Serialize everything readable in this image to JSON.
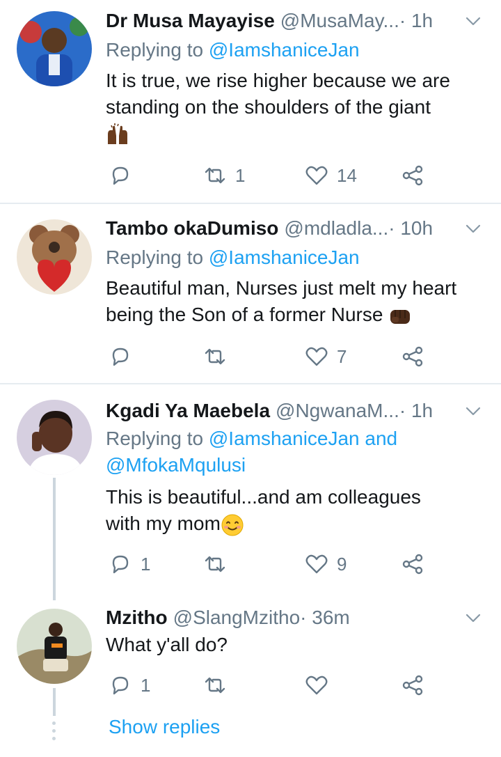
{
  "tweets": [
    {
      "name": "Dr Musa Mayayise",
      "handle": "@MusaMay...",
      "time": " · 1h",
      "replying_prefix": "Replying to ",
      "replying_to": "@IamshaniceJan",
      "text_line1": "It is true, we rise higher because we are",
      "text_line2": "standing on the shoulders of the giant",
      "emoji": "raising-hands-emoji",
      "replies": "",
      "retweets": "1",
      "likes": "14"
    },
    {
      "name": "Tambo okaDumiso",
      "handle": "@mdladla...",
      "time": " · 10h",
      "replying_prefix": "Replying to ",
      "replying_to": "@IamshaniceJan",
      "text_line1": "Beautiful man, Nurses just melt my heart",
      "text_line2": "being the Son of a former Nurse ",
      "emoji": "fist-emoji",
      "replies": "",
      "retweets": "",
      "likes": "7"
    },
    {
      "name": "Kgadi Ya Maebela",
      "handle": "@NgwanaM...",
      "time": " · 1h",
      "replying_prefix": "Replying to ",
      "replying_to": "@IamshaniceJan and",
      "replying_to2": "@MfokaMqulusi",
      "text_line1": "This is beautiful...and am colleagues",
      "text_line2": "with my mom",
      "emoji": "smiling-face-emoji",
      "replies": "1",
      "retweets": "",
      "likes": "9"
    },
    {
      "name": "Mzitho",
      "handle": "@SlangMzitho",
      "time": " · 36m",
      "text_line1": "What y'all do?",
      "replies": "1",
      "retweets": "",
      "likes": ""
    }
  ],
  "show_replies": "Show replies",
  "colors": {
    "link": "#1da1f2",
    "secondary_text": "#657786",
    "divider": "#e6ecf0",
    "thread_line": "#ccd6dd"
  }
}
